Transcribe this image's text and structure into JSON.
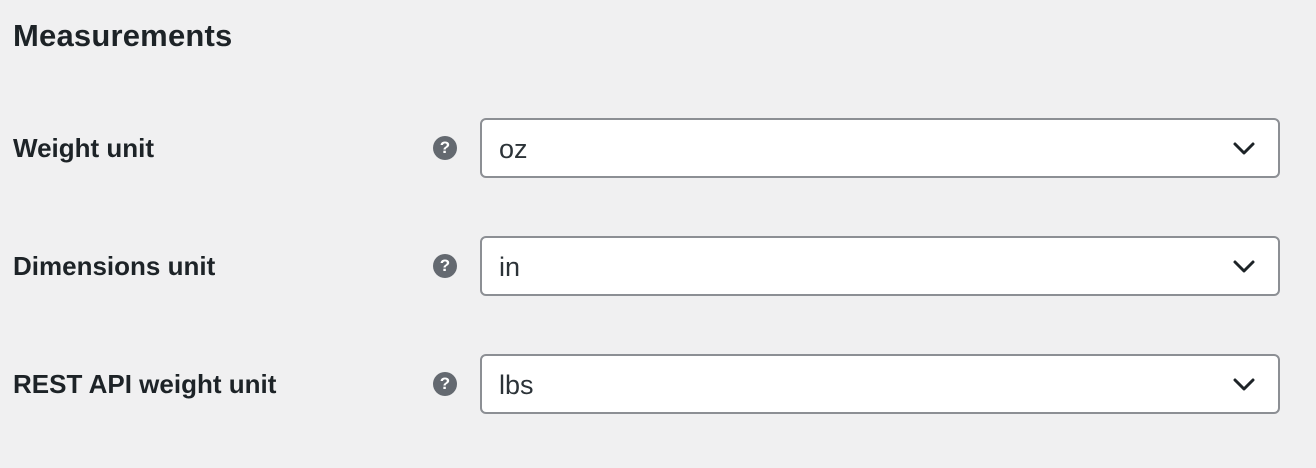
{
  "section": {
    "title": "Measurements"
  },
  "fields": [
    {
      "label": "Weight unit",
      "value": "oz",
      "help_icon": "?"
    },
    {
      "label": "Dimensions unit",
      "value": "in",
      "help_icon": "?"
    },
    {
      "label": "REST API weight unit",
      "value": "lbs",
      "help_icon": "?"
    }
  ],
  "icons": {
    "help": "question-circle-icon",
    "dropdown": "chevron-down-icon"
  },
  "colors": {
    "background": "#f0f0f1",
    "help_icon_bg": "#646970",
    "select_border": "#8c8f94",
    "text": "#1d2327"
  }
}
